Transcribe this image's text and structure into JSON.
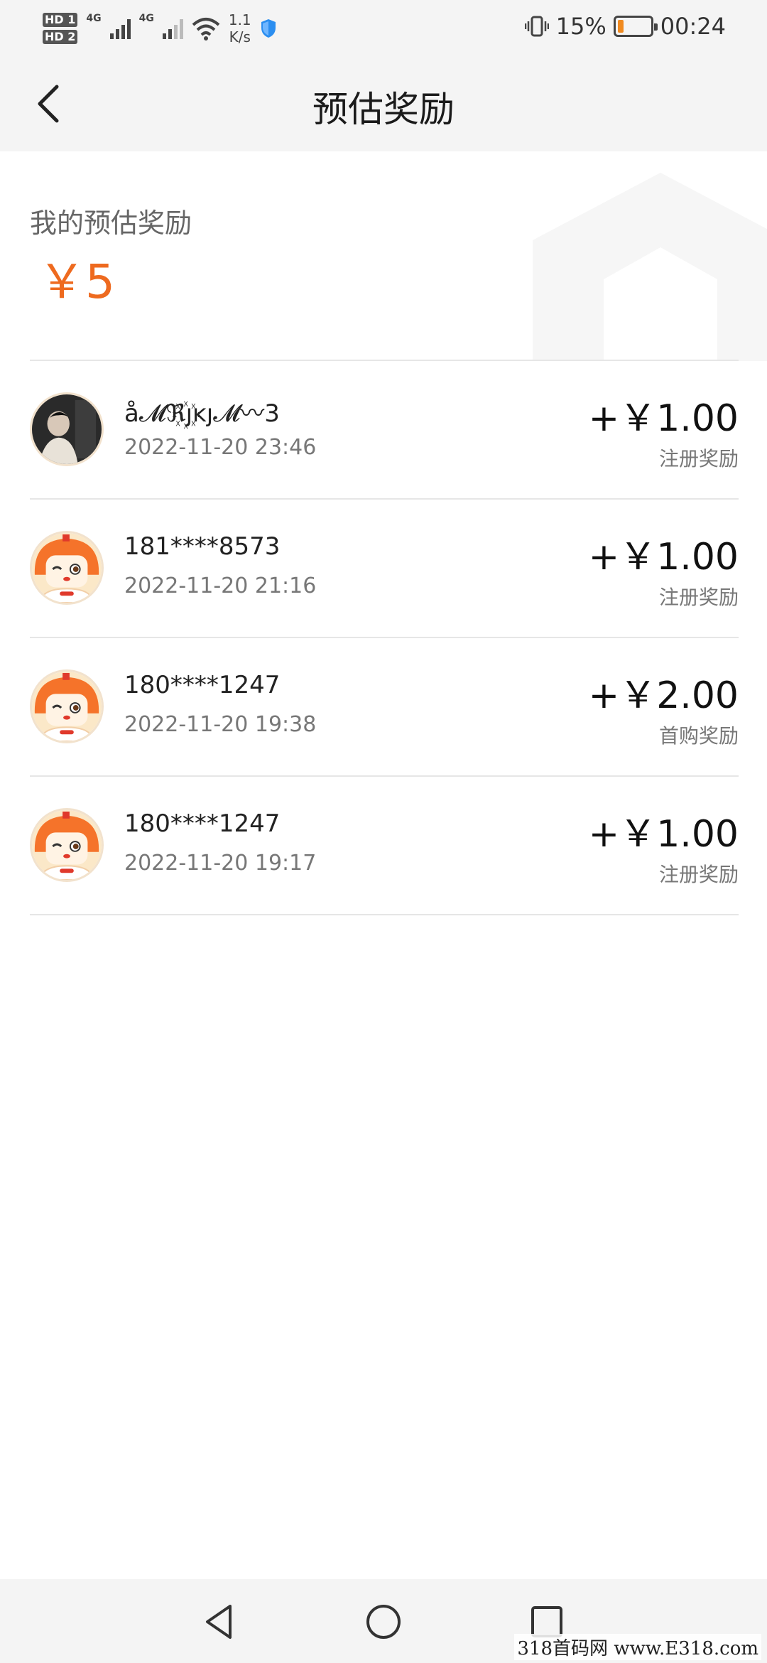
{
  "status_bar": {
    "hd1": "HD 1",
    "hd2": "HD 2",
    "net1": "4G",
    "net2": "4G",
    "speed_value": "1.1",
    "speed_unit": "K/s",
    "battery": "15%",
    "time": "00:24",
    "battery_color": "#f08a1f"
  },
  "header": {
    "title": "预估奖励",
    "back_icon": "chevron-left-icon"
  },
  "summary": {
    "label": "我的预估奖励",
    "amount": "￥5",
    "accent_color": "#ee6a1f"
  },
  "rewards": [
    {
      "name": "å𝓜ℜ꙰ȷĸȷ𝓜〰3",
      "time": "2022-11-20 23:46",
      "amount": "+￥1.00",
      "type": "注册奖励",
      "avatar": "photo"
    },
    {
      "name": "181****8573",
      "time": "2022-11-20 21:16",
      "amount": "+￥1.00",
      "type": "注册奖励",
      "avatar": "mascot"
    },
    {
      "name": "180****1247",
      "time": "2022-11-20 19:38",
      "amount": "+￥2.00",
      "type": "首购奖励",
      "avatar": "mascot"
    },
    {
      "name": "180****1247",
      "time": "2022-11-20 19:17",
      "amount": "+￥1.00",
      "type": "注册奖励",
      "avatar": "mascot"
    }
  ],
  "watermark": "318首码网 www.E318.com"
}
